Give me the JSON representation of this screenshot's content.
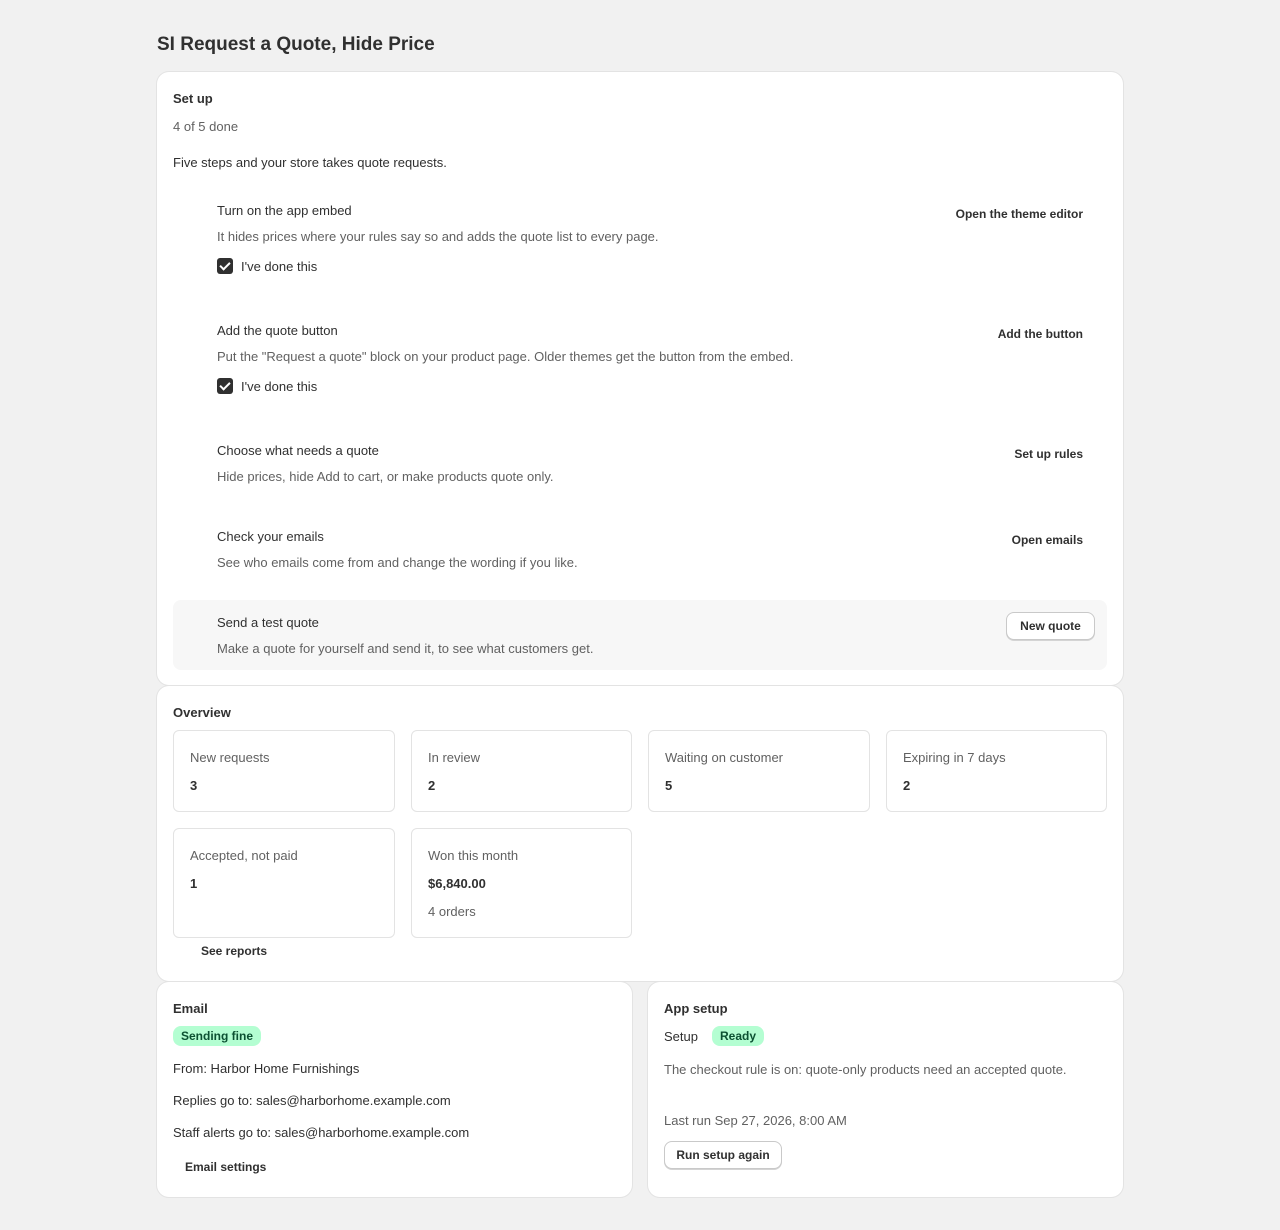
{
  "app": {
    "title": "SI Request a Quote, Hide Price"
  },
  "setup": {
    "title": "Set up",
    "progress_text": "4 of 5 done",
    "progress": {
      "done": 4,
      "total": 5
    },
    "intro": "Five steps and your store takes quote requests.",
    "steps": [
      {
        "title": "Turn on the app embed",
        "description": "It hides prices where your rules say so and adds the quote list to every page.",
        "action": "Open the theme editor",
        "checkbox_label": "I've done this",
        "checked": true
      },
      {
        "title": "Add the quote button",
        "description": "Put the \"Request a quote\" block on your product page. Older themes get the button from the embed.",
        "action": "Add the button",
        "checkbox_label": "I've done this",
        "checked": true
      },
      {
        "title": "Choose what needs a quote",
        "description": "Hide prices, hide Add to cart, or make products quote only.",
        "action": "Set up rules"
      },
      {
        "title": "Check your emails",
        "description": "See who emails come from and change the wording if you like.",
        "action": "Open emails"
      },
      {
        "title": "Send a test quote",
        "description": "Make a quote for yourself and send it, to see what customers get.",
        "action": "New quote"
      }
    ]
  },
  "overview": {
    "title": "Overview",
    "stats": [
      {
        "label": "New requests",
        "value": "3"
      },
      {
        "label": "In review",
        "value": "2"
      },
      {
        "label": "Waiting on customer",
        "value": "5"
      },
      {
        "label": "Expiring in 7 days",
        "value": "2"
      },
      {
        "label": "Accepted, not paid",
        "value": "1"
      },
      {
        "label": "Won this month",
        "value": "$6,840.00",
        "sub": "4 orders"
      }
    ],
    "reports_link": "See reports"
  },
  "email": {
    "title": "Email",
    "status_badge": "Sending fine",
    "status_color": "#b4fed2",
    "from": "From: Harbor Home Furnishings",
    "replies": "Replies go to: sales@harborhome.example.com",
    "staff_alerts": "Staff alerts go to: sales@harborhome.example.com",
    "settings_link": "Email settings"
  },
  "app_setup": {
    "title": "App setup",
    "setup_label": "Setup",
    "status_badge": "Ready",
    "status_color": "#b4fed2",
    "description": "The checkout rule is on: quote-only products need an accepted quote.",
    "last_run": "Last run Sep 27, 2026, 8:00 AM",
    "run_button": "Run setup again"
  }
}
